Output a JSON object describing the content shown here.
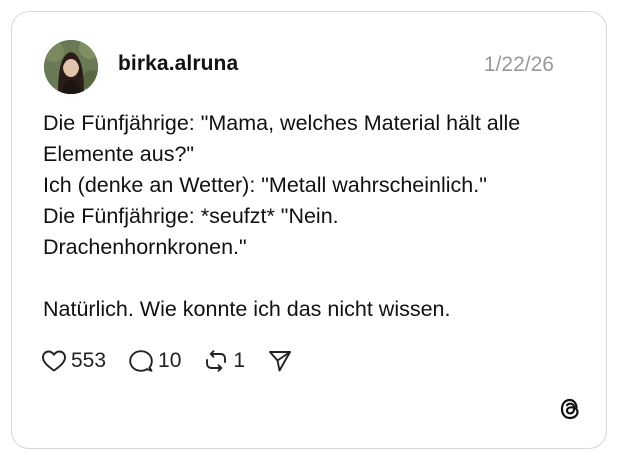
{
  "post": {
    "author": "birka.alruna",
    "date": "1/22/26",
    "lines": [
      "Die Fünfjährige: \"Mama, welches Material hält alle",
      "Elemente aus?\"",
      "Ich (denke an Wetter): \"Metall wahrscheinlich.\"",
      "Die Fünfjährige: *seufzt* \"Nein.",
      "Drachenhornkronen.\"",
      "",
      "Natürlich. Wie konnte ich das nicht wissen."
    ]
  },
  "actions": {
    "likes": "553",
    "replies": "10",
    "reposts": "1"
  },
  "icons": {
    "like": "heart-icon",
    "reply": "speech-bubble-icon",
    "repost": "repost-icon",
    "share": "send-icon",
    "brand": "threads-logo-icon"
  },
  "colors": {
    "text": "#111111",
    "muted": "#9a9a9a",
    "border": "#d8d8d8"
  }
}
